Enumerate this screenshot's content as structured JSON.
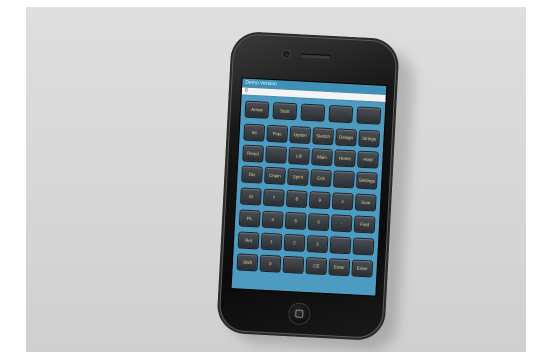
{
  "app": {
    "title": "Demo Version",
    "display_value": "0"
  },
  "keypad": {
    "rows": [
      [
        "Arrow",
        "Start",
        "",
        "",
        ""
      ],
      [
        "Int",
        "Frac",
        "Option",
        "Sketch",
        "Design",
        "Strings"
      ],
      [
        "Reset",
        "",
        "Lib",
        "Main",
        "Home",
        "Hold"
      ],
      [
        "Div",
        "Chain",
        "Spirit",
        "Cos",
        "",
        "Settings"
      ],
      [
        "St",
        "7",
        "8",
        "9",
        "x",
        "Sum"
      ],
      [
        "PL",
        "4",
        "5",
        "6",
        "-",
        "Find"
      ],
      [
        "Ret",
        "1",
        "2",
        "3",
        "",
        ""
      ],
      [
        "Shift",
        "0",
        "",
        "CE",
        "Enter",
        "Enter"
      ]
    ]
  },
  "colors": {
    "accent": "#4d9bc0",
    "key_text": "#e8d38a",
    "phone_body": "#111111",
    "background": "#d9d9d9"
  },
  "icons": {
    "home_button": "home-button-icon",
    "camera": "front-camera-icon",
    "speaker": "earpiece-speaker-icon"
  }
}
